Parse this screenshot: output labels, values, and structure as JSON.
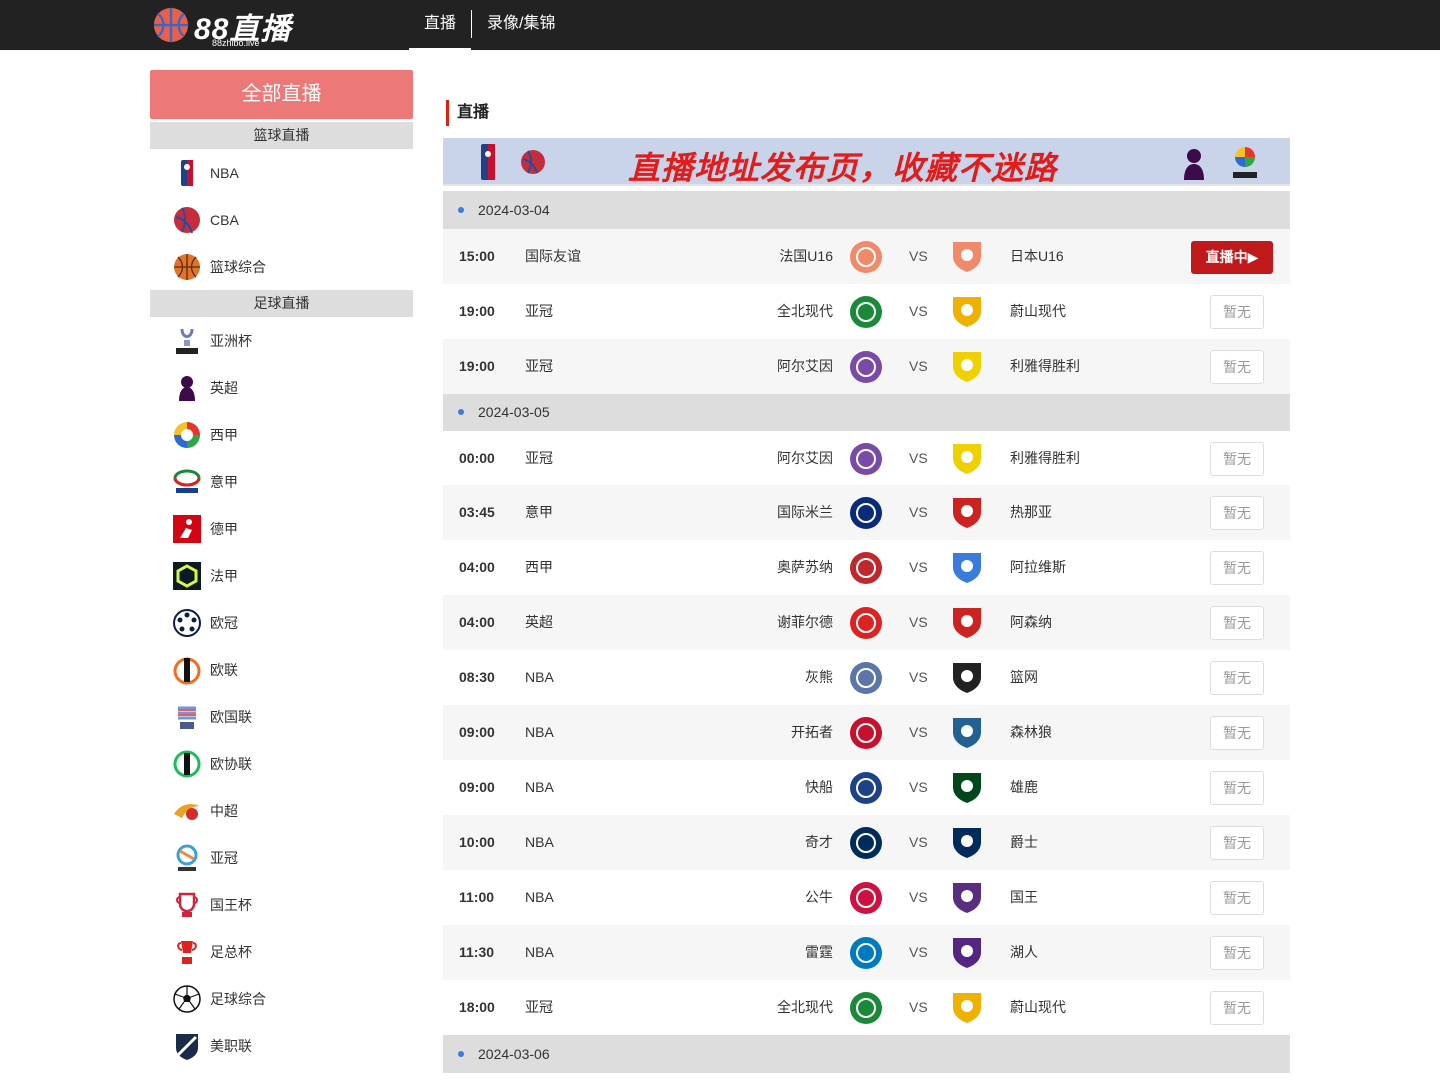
{
  "brand": {
    "name": "88直播",
    "sub": "88zhibo.live"
  },
  "nav": {
    "items": [
      "直播",
      "录像/集锦"
    ]
  },
  "sidebar": {
    "all_label": "全部直播",
    "basketball_head": "篮球直播",
    "basketball_items": [
      "NBA",
      "CBA",
      "篮球综合"
    ],
    "football_head": "足球直播",
    "football_items": [
      "亚洲杯",
      "英超",
      "西甲",
      "意甲",
      "德甲",
      "法甲",
      "欧冠",
      "欧联",
      "欧国联",
      "欧协联",
      "中超",
      "亚冠",
      "国王杯",
      "足总杯",
      "足球综合",
      "美职联"
    ]
  },
  "main": {
    "section_title": "直播",
    "banner_text": "直播地址发布页，收藏不迷路",
    "dates": [
      "2024-03-04",
      "2024-03-05",
      "2024-03-06"
    ],
    "vs_label": "VS",
    "live_label": "直播中▶",
    "none_label": "暂无",
    "matches": [
      {
        "time": "15:00",
        "league": "国际友谊",
        "home": "法国U16",
        "away": "日本U16",
        "status": "live"
      },
      {
        "time": "19:00",
        "league": "亚冠",
        "home": "全北现代",
        "away": "蔚山现代",
        "status": "none"
      },
      {
        "time": "19:00",
        "league": "亚冠",
        "home": "阿尔艾因",
        "away": "利雅得胜利",
        "status": "none"
      },
      {
        "time": "00:00",
        "league": "亚冠",
        "home": "阿尔艾因",
        "away": "利雅得胜利",
        "status": "none"
      },
      {
        "time": "03:45",
        "league": "意甲",
        "home": "国际米兰",
        "away": "热那亚",
        "status": "none"
      },
      {
        "time": "04:00",
        "league": "西甲",
        "home": "奥萨苏纳",
        "away": "阿拉维斯",
        "status": "none"
      },
      {
        "time": "04:00",
        "league": "英超",
        "home": "谢菲尔德",
        "away": "阿森纳",
        "status": "none"
      },
      {
        "time": "08:30",
        "league": "NBA",
        "home": "灰熊",
        "away": "篮网",
        "status": "none"
      },
      {
        "time": "09:00",
        "league": "NBA",
        "home": "开拓者",
        "away": "森林狼",
        "status": "none"
      },
      {
        "time": "09:00",
        "league": "NBA",
        "home": "快船",
        "away": "雄鹿",
        "status": "none"
      },
      {
        "time": "10:00",
        "league": "NBA",
        "home": "奇才",
        "away": "爵士",
        "status": "none"
      },
      {
        "time": "11:00",
        "league": "NBA",
        "home": "公牛",
        "away": "国王",
        "status": "none"
      },
      {
        "time": "11:30",
        "league": "NBA",
        "home": "雷霆",
        "away": "湖人",
        "status": "none"
      },
      {
        "time": "18:00",
        "league": "亚冠",
        "home": "全北现代",
        "away": "蔚山现代",
        "status": "none"
      }
    ]
  },
  "colors": {
    "accent": "#ec7878",
    "live": "#c0191b",
    "dot": "#3a7be0",
    "topbar": "#222222"
  }
}
